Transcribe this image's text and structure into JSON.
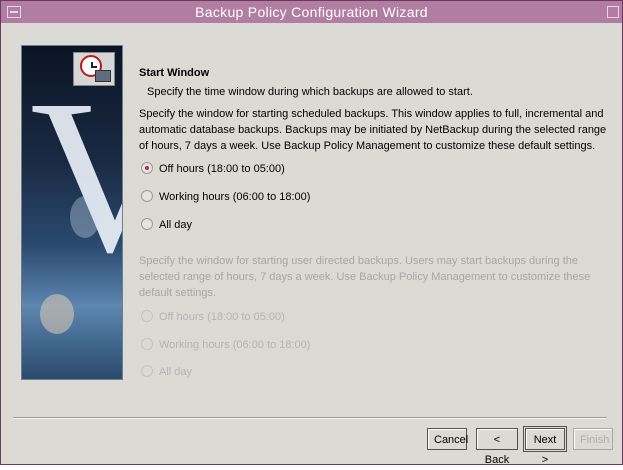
{
  "window": {
    "title": "Backup Policy Configuration Wizard"
  },
  "page": {
    "heading": "Start Window",
    "subheading": "Specify the time window during which backups are allowed to start.",
    "scheduled_description": "Specify the window for starting scheduled backups. This window applies to full, incremental and automatic database backups. Backups may be initiated by NetBackup during the selected range of hours, 7 days a week. Use Backup Policy Management to customize these default settings.",
    "scheduled_options": [
      {
        "label": "Off hours (18:00 to 05:00)",
        "selected": true
      },
      {
        "label": "Working hours (06:00 to 18:00)",
        "selected": false
      },
      {
        "label": "All day",
        "selected": false
      }
    ],
    "user_description": "Specify the window for starting user directed backups. Users may start backups during the selected range of hours, 7 days a week. Use Backup Policy Management to customize these default settings.",
    "user_options": [
      {
        "label": "Off hours (18:00 to 05:00)",
        "enabled": false
      },
      {
        "label": "Working hours (06:00 to 18:00)",
        "enabled": false
      },
      {
        "label": "All day",
        "enabled": false
      }
    ]
  },
  "buttons": {
    "cancel": "Cancel",
    "back": "< Back",
    "next": "Next >",
    "finish": "Finish"
  },
  "colors": {
    "titlebar": "#b27da2",
    "selected_radio": "#b2286a"
  }
}
